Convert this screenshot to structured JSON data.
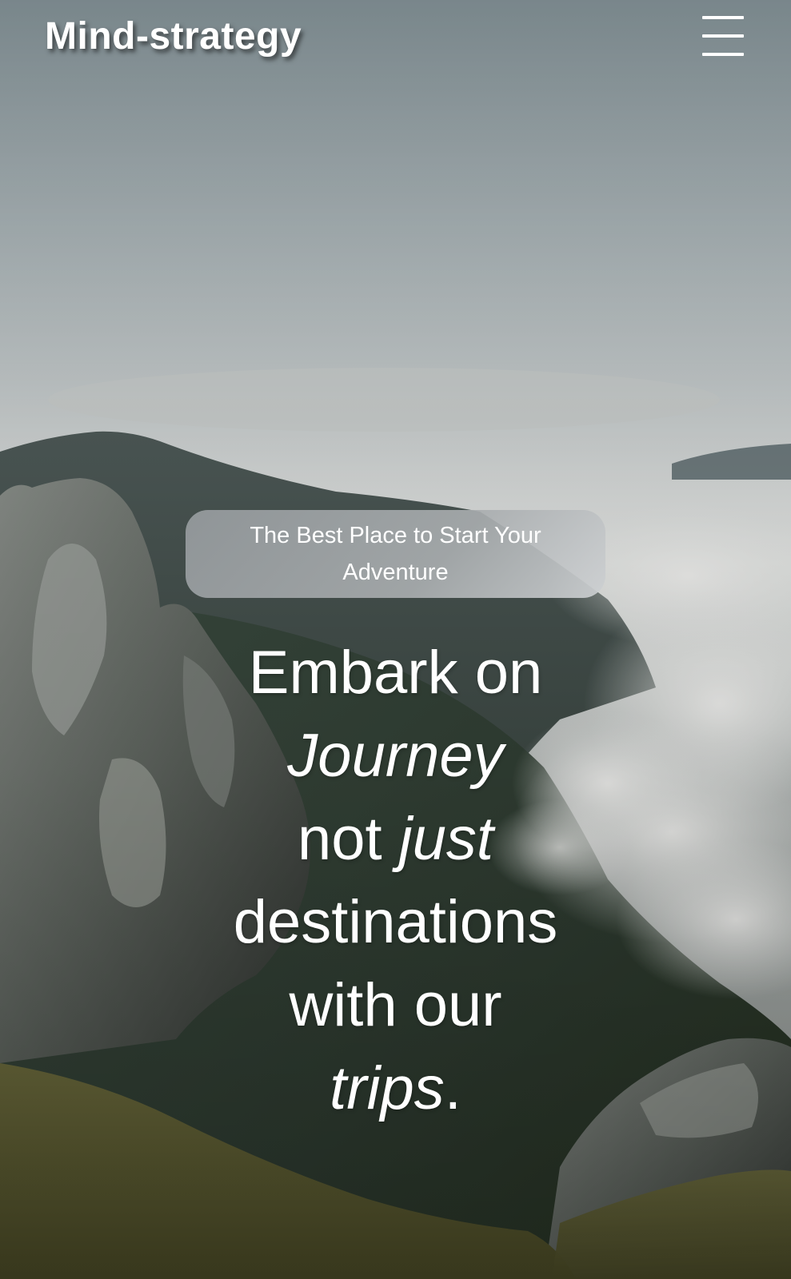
{
  "header": {
    "brand": "Mind-strategy",
    "menu_icon": "hamburger-menu-icon"
  },
  "hero": {
    "tagline": "The Best Place to Start Your Adventure",
    "headline": {
      "line1": "Embark on",
      "line2_italic": "Journey",
      "line3_plain": "not",
      "line3_italic": "just",
      "line4": "destinations",
      "line5": "with our",
      "line6_italic": "trips",
      "line6_plain": "."
    }
  },
  "colors": {
    "text": "#ffffff",
    "tagline_bg": "#a9adb0",
    "sky": "#c3c9ca"
  }
}
